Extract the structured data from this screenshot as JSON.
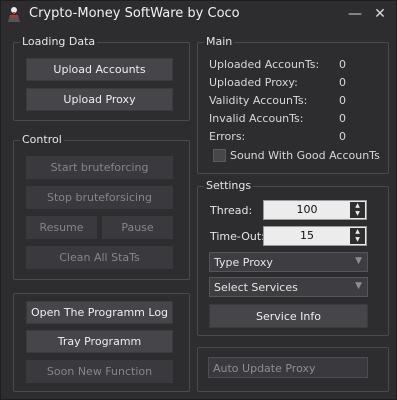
{
  "window": {
    "title": "Crypto-Money SoftWare by Coco",
    "minimize_glyph": "—",
    "close_glyph": "✕"
  },
  "loading": {
    "title": "Loading Data",
    "upload_accounts": "Upload Accounts",
    "upload_proxy": "Upload Proxy"
  },
  "control": {
    "title": "Control",
    "start": "Start bruteforcing",
    "stop": "Stop bruteforsicing",
    "resume": "Resume",
    "pause": "Pause",
    "clean": "Clean All StaTs"
  },
  "misc": {
    "open_log": "Open The Programm Log",
    "tray": "Tray Programm",
    "soon": "Soon New Function"
  },
  "main": {
    "title": "Main",
    "stats": [
      {
        "label": "Uploaded AccounTs:",
        "value": "0"
      },
      {
        "label": "Uploaded Proxy:",
        "value": "0"
      },
      {
        "label": "Validity AccounTs:",
        "value": "0"
      },
      {
        "label": "Invalid AccounTs:",
        "value": "0"
      },
      {
        "label": "Errors:",
        "value": "0"
      }
    ],
    "sound_label": "Sound With Good AccounTs",
    "sound_checked": false
  },
  "settings": {
    "title": "Settings",
    "thread_label": "Thread:",
    "thread_value": "100",
    "timeout_label": "Time-Out:",
    "timeout_value": "15",
    "proxy_type": "Type Proxy",
    "services": "Select Services",
    "service_info": "Service Info"
  },
  "auto_update": {
    "placeholder": "Auto Update Proxy"
  },
  "colors": {
    "background": "#2d2d30",
    "button": "#45454a",
    "border": "#4a4a4d"
  },
  "icons": {
    "app": "user-icon",
    "spin_up": "triangle-up-icon",
    "spin_down": "triangle-down-icon",
    "dropdown": "triangle-down-icon"
  }
}
